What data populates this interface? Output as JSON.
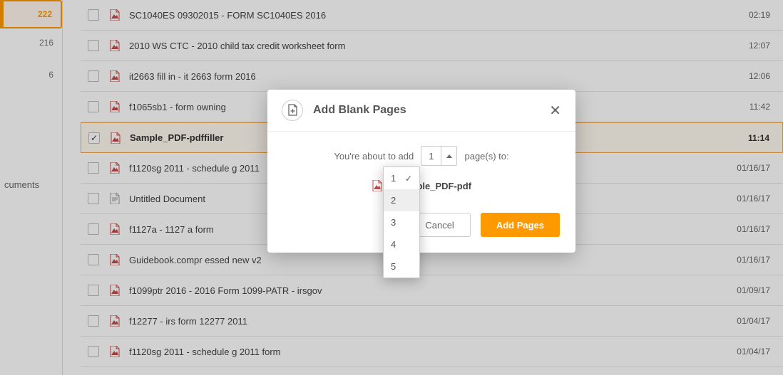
{
  "sidebar": {
    "counts": [
      "222",
      "216",
      "6"
    ],
    "label": "cuments"
  },
  "files": [
    {
      "name": "SC1040ES 09302015 - FORM SC1040ES 2016",
      "time": "02:19",
      "icon": "pdf"
    },
    {
      "name": "2010 WS CTC - 2010 child tax credit worksheet form",
      "time": "12:07",
      "icon": "pdf"
    },
    {
      "name": "it2663 fill in - it 2663 form 2016",
      "time": "12:06",
      "icon": "pdf"
    },
    {
      "name": "f1065sb1 - form owning",
      "time": "11:42",
      "icon": "pdf"
    },
    {
      "name": "Sample_PDF-pdffiller",
      "time": "11:14",
      "icon": "pdf",
      "selected": true
    },
    {
      "name": "f1120sg 2011 - schedule g 2011",
      "time": "01/16/17",
      "icon": "pdf",
      "truncate": "f1120sg 2011 - schedule g 2011 form"
    },
    {
      "name": "Untitled Document",
      "time": "01/16/17",
      "icon": "doc"
    },
    {
      "name": "f1127a - 1127 a form",
      "time": "01/16/17",
      "icon": "pdf"
    },
    {
      "name": "Guidebook.compr essed new v2",
      "time": "01/16/17",
      "icon": "pdf"
    },
    {
      "name": "f1099ptr 2016 - 2016 Form 1099-PATR - irsgov",
      "time": "01/09/17",
      "icon": "pdf"
    },
    {
      "name": "f12277 - irs form 12277 2011",
      "time": "01/04/17",
      "icon": "pdf"
    },
    {
      "name": "f1120sg 2011 - schedule g 2011 form",
      "time": "01/04/17",
      "icon": "pdf"
    }
  ],
  "modal": {
    "title": "Add Blank Pages",
    "text_before": "You're about to add",
    "text_after": "page(s) to:",
    "value": "1",
    "target": "Sample_PDF-pdf",
    "cancel": "Cancel",
    "add": "Add Pages",
    "options": [
      "1",
      "2",
      "3",
      "4",
      "5"
    ]
  }
}
